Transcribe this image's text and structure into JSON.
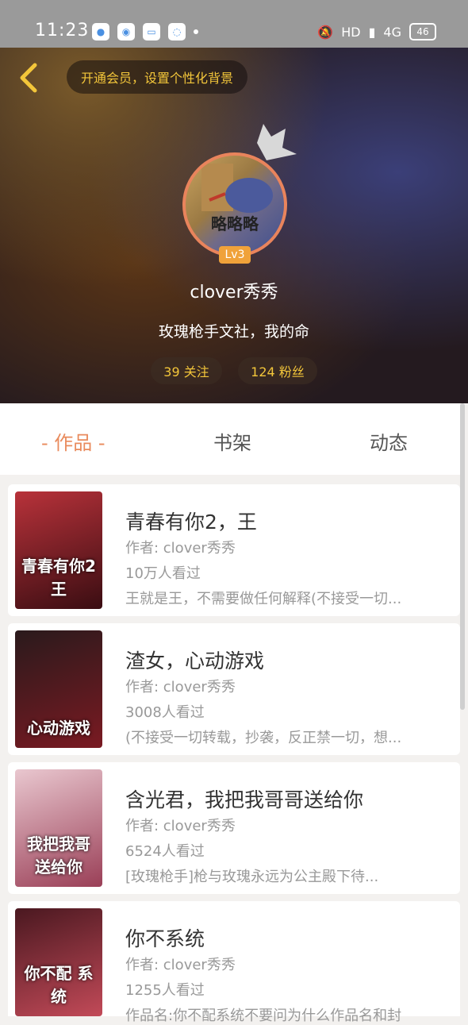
{
  "status": {
    "time": "11:23",
    "net": "HD",
    "net2": "4G",
    "battery": "46"
  },
  "header": {
    "vip_banner": "开通会员，设置个性化背景"
  },
  "profile": {
    "avatar_text": "略略略",
    "level": "Lv3",
    "username": "clover秀秀",
    "bio": "玫瑰枪手文社，我的命",
    "following": "39 关注",
    "followers": "124 粉丝"
  },
  "tabs": [
    {
      "label": "- 作品 -",
      "active": true
    },
    {
      "label": "书架",
      "active": false
    },
    {
      "label": "动态",
      "active": false
    }
  ],
  "works": [
    {
      "title": "青春有你2，王",
      "author": "作者: clover秀秀",
      "views": "10万人看过",
      "desc": "王就是王，不需要做任何解释(不接受一切...",
      "cover_text": "青春有你2 王",
      "cover_color": "#8b1c24"
    },
    {
      "title": "渣女，心动游戏",
      "author": "作者: clover秀秀",
      "views": "3008人看过",
      "desc": "(不接受一切转载，抄袭，反正禁一切，想...",
      "cover_text": "心动游戏",
      "cover_color": "#5a0f14"
    },
    {
      "title": "含光君，我把我哥哥送给你",
      "author": "作者: clover秀秀",
      "views": "6524人看过",
      "desc": "[玫瑰枪手]枪与玫瑰永远为公主殿下待...",
      "cover_text": "我把我哥 送给你",
      "cover_color": "#c88a96"
    },
    {
      "title": "你不系统",
      "author": "作者: clover秀秀",
      "views": "1255人看过",
      "desc": "作品名:你不配系统不要问为什么作品名和封",
      "cover_text": "你不配 系统",
      "cover_color": "#3a1218"
    }
  ]
}
